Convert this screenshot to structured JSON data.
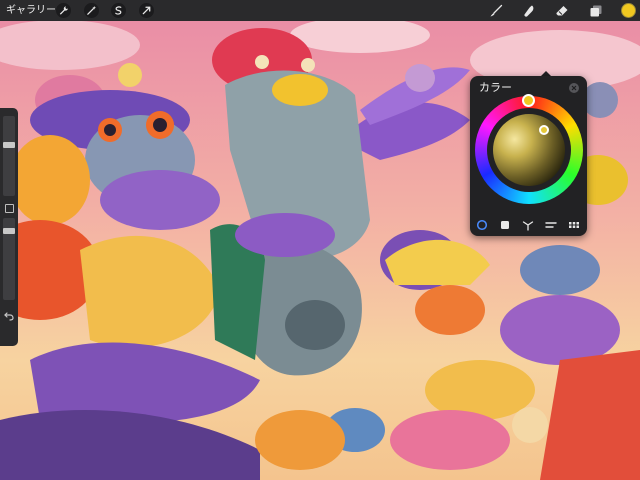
{
  "toolbar": {
    "gallery_label": "ギャラリー",
    "left_tools": [
      {
        "name": "wrench-icon"
      },
      {
        "name": "adjustments-wand-icon"
      },
      {
        "name": "selection-icon"
      },
      {
        "name": "transform-arrow-icon"
      }
    ],
    "right_tools": [
      {
        "name": "brush-icon"
      },
      {
        "name": "smudge-icon"
      },
      {
        "name": "eraser-icon"
      },
      {
        "name": "layers-icon"
      }
    ],
    "current_color": "#f0c820"
  },
  "color_panel": {
    "title": "カラー",
    "selected_color": "#e7c93a",
    "hue_color": "#f0c820",
    "tabs": [
      {
        "name": "disc-tab-icon",
        "active": true
      },
      {
        "name": "classic-tab-icon",
        "active": false
      },
      {
        "name": "harmony-tab-icon",
        "active": false
      },
      {
        "name": "value-tab-icon",
        "active": false
      },
      {
        "name": "palette-tab-icon",
        "active": false
      }
    ]
  },
  "colors": {
    "ui_bar": "#2a2a2c",
    "active_tab": "#4a8cff"
  }
}
